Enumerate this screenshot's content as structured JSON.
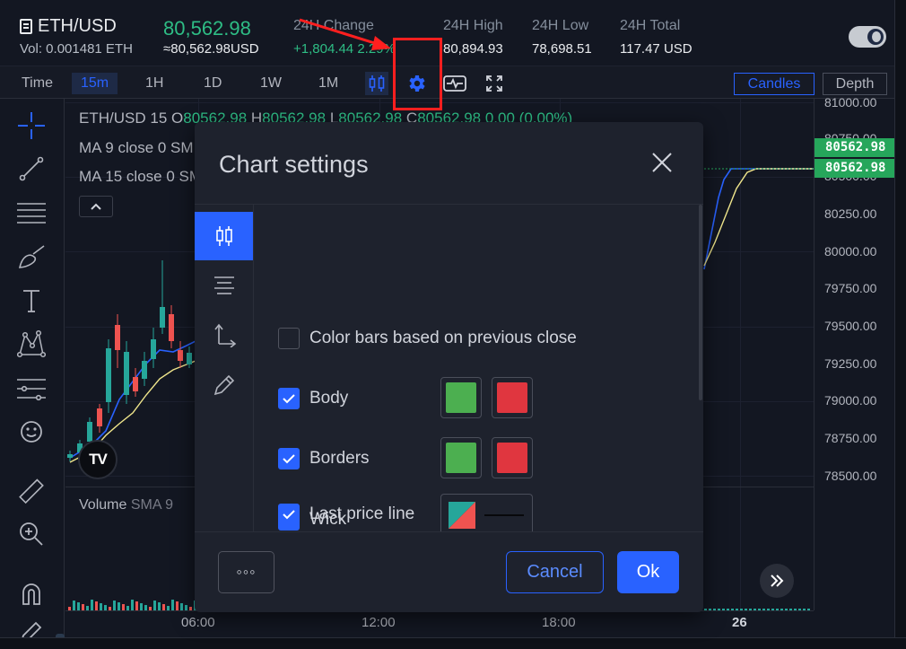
{
  "ticker": {
    "pair": "ETH/USD",
    "volume": "Vol: 0.001481 ETH",
    "last_price": "80,562.98",
    "last_price_usd": "≈80,562.98",
    "last_price_usd_unit": "USD",
    "change_label": "24H Change",
    "change_value": "+1,804.44",
    "change_pct": "2.29%",
    "high_label": "24H High",
    "high_value": "80,894.93",
    "low_label": "24H Low",
    "low_value": "78,698.51",
    "total_label": "24H Total",
    "total_value": "117.47",
    "total_unit": "USD",
    "theme_toggle_icon": "moon-icon"
  },
  "toolbar": {
    "time_label": "Time",
    "intervals": [
      "15m",
      "1H",
      "1D",
      "1W",
      "1M"
    ],
    "active_interval": "15m",
    "icons": [
      "candles-icon",
      "gear-icon",
      "indicators-icon",
      "fullscreen-icon"
    ],
    "candles_label": "Candles",
    "depth_label": "Depth"
  },
  "left_tools": [
    "crosshair-icon",
    "trend-line-icon",
    "horizontal-lines-icon",
    "brush-icon",
    "text-icon",
    "pattern-icon",
    "measure-lines-icon",
    "emoji-icon",
    "ruler-icon",
    "zoom-in-icon",
    "magnet-icon",
    "pencil-lock-icon"
  ],
  "chart": {
    "legend": {
      "symbol": "ETH/USD",
      "interval": "15",
      "o_label": "O",
      "o_value": "80562.98",
      "h_label": "H",
      "h_value": "80562.98",
      "l_label": "L",
      "l_value": "80562.98",
      "c_label": "C",
      "c_value": "80562.98",
      "change": "0.00 (0.00%)",
      "ma1_label": "MA",
      "ma1_params": "9 close 0 SM",
      "ma2_label": "MA",
      "ma2_params": "15 close 0 SM",
      "collapse_icon": "chevron-up-icon"
    },
    "volume_label": "Volume",
    "volume_params": "SMA 9",
    "price_ticks": [
      "81000.00",
      "80750.00",
      "80500.00",
      "80250.00",
      "80000.00",
      "79750.00",
      "79500.00",
      "79250.00",
      "79000.00",
      "78750.00",
      "78500.00"
    ],
    "price_tags": [
      "80562.98",
      "80562.98"
    ],
    "time_ticks": [
      "06:00",
      "12:00",
      "18:00",
      "26"
    ],
    "colors": {
      "up": "#26a69a",
      "down": "#ef5350",
      "ma_fast": "#2962ff",
      "ma_slow": "#f0e68c",
      "tag": "#26a65b"
    }
  },
  "modal": {
    "title": "Chart settings",
    "close_icon": "close-icon",
    "tabs": [
      "candles-icon",
      "text-lines-icon",
      "axes-icon",
      "pencil-icon"
    ],
    "active_tab": 0,
    "options": [
      {
        "label": "Color bars based on previous close",
        "checked": false
      },
      {
        "label": "Body",
        "checked": true,
        "up_color": "#4caf50",
        "down_color": "#e0363f"
      },
      {
        "label": "Borders",
        "checked": true,
        "up_color": "#4caf50",
        "down_color": "#e0363f"
      },
      {
        "label": "Wick",
        "checked": true,
        "up_color": "#4caf50",
        "down_color": "#e0363f"
      },
      {
        "label": "Last price line",
        "checked": true
      }
    ],
    "more_label": "◦◦◦",
    "cancel_label": "Cancel",
    "ok_label": "Ok"
  }
}
